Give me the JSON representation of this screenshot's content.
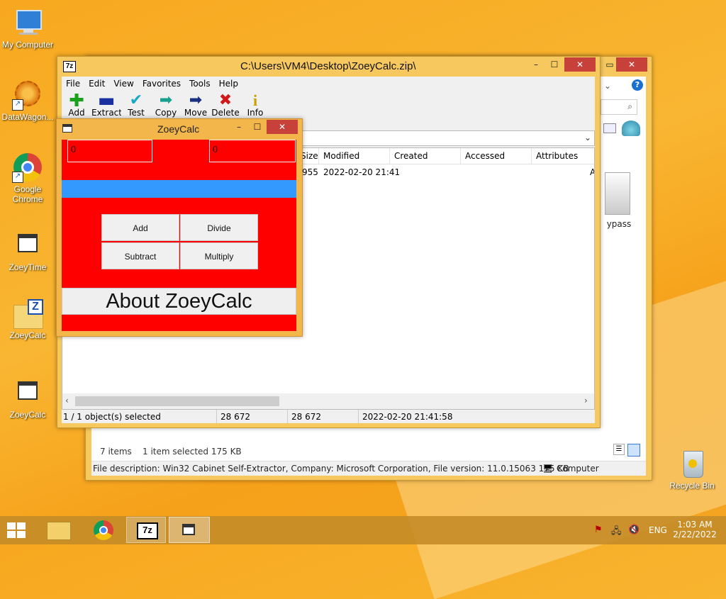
{
  "desktop": {
    "icons": [
      {
        "label": "My Computer"
      },
      {
        "label": "DataWagon..."
      },
      {
        "label": "Google Chrome"
      },
      {
        "label": "ZoeyTime"
      },
      {
        "label": "ZoeyCalc"
      },
      {
        "label": "ZoeyCalc"
      },
      {
        "label": "Recycle Bin"
      }
    ]
  },
  "explorer": {
    "status_items": "7 items",
    "status_selected": "1 item selected  175 KB",
    "details": "File description: Win32 Cabinet Self-Extractor, Company: Microsoft Corporation, File version: 11.0.15063 175 KB",
    "computer_label": "Computer",
    "file_label": "Bypass",
    "partial_label": "ypass"
  },
  "sevenzip": {
    "title": "C:\\Users\\VM4\\Desktop\\ZoeyCalc.zip\\",
    "app_icon": "7z",
    "menu": [
      "File",
      "Edit",
      "View",
      "Favorites",
      "Tools",
      "Help"
    ],
    "toolbar": [
      {
        "label": "Add",
        "icon": "plus-icon",
        "color": "#1aa01a"
      },
      {
        "label": "Extract",
        "icon": "minus-icon",
        "color": "#1a2fa0"
      },
      {
        "label": "Test",
        "icon": "check-icon",
        "color": "#1aa8c8"
      },
      {
        "label": "Copy",
        "icon": "copy-arrow-icon",
        "color": "#17a090"
      },
      {
        "label": "Move",
        "icon": "move-arrow-icon",
        "color": "#1a2f80"
      },
      {
        "label": "Delete",
        "icon": "delete-x-icon",
        "color": "#d01818"
      },
      {
        "label": "Info",
        "icon": "info-icon",
        "color": "#c8a000"
      }
    ],
    "columns": [
      "Size",
      "Modified",
      "Created",
      "Accessed",
      "Attributes"
    ],
    "row": {
      "size": "955",
      "modified": "2022-02-20 21:41",
      "created": "",
      "accessed": "",
      "attributes": "A"
    },
    "status": {
      "selected": "1 / 1 object(s) selected",
      "size": "28 672",
      "packed": "28 672",
      "modified": "2022-02-20 21:41:58"
    }
  },
  "zoeycalc": {
    "title": "ZoeyCalc",
    "input1": "0",
    "input2": "0",
    "buttons": {
      "add": "Add",
      "divide": "Divide",
      "subtract": "Subtract",
      "multiply": "Multiply"
    },
    "about": "About ZoeyCalc",
    "colors": {
      "red": "#ff0000",
      "blue": "#3399ff"
    }
  },
  "taskbar": {
    "lang": "ENG",
    "time": "1:03 AM",
    "date": "2/22/2022",
    "seven_zip_label": "7z"
  }
}
